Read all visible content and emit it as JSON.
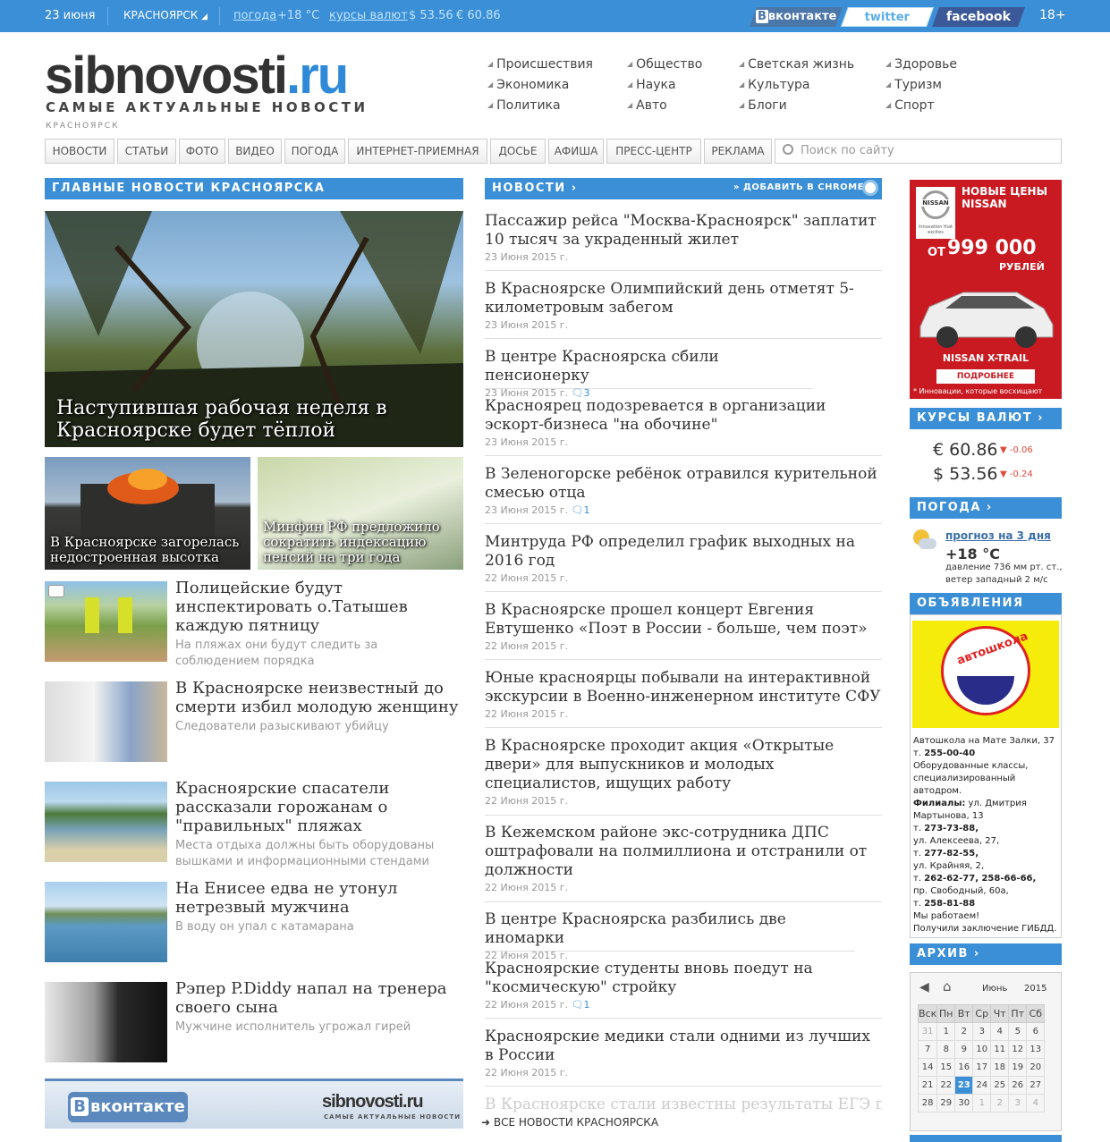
{
  "topbar": {
    "date": "23 июня",
    "city": "КРАСНОЯРСК",
    "weather_label": "погода",
    "weather_value": "+18 °С",
    "rates_label": "курсы валют",
    "usd": "$ 53.56",
    "eur": "€ 60.86",
    "vk": "вконтакте",
    "twitter": "twitter",
    "facebook": "facebook",
    "age": "18+"
  },
  "header": {
    "logo_main": "sibnovosti",
    "logo_tld": ".ru",
    "slogan": "САМЫЕ АКТУАЛЬНЫЕ НОВОСТИ",
    "city": "КРАСНОЯРСК"
  },
  "categories": [
    "Происшествия",
    "Экономика",
    "Политика",
    "Общество",
    "Наука",
    "Авто",
    "Светская жизнь",
    "Культура",
    "Блоги",
    "Здоровье",
    "Туризм",
    "Спорт"
  ],
  "nav": [
    "НОВОСТИ",
    "СТАТЬИ",
    "ФОТО",
    "ВИДЕО",
    "ПОГОДА",
    "ИНТЕРНЕТ-ПРИЕМНАЯ",
    "ДОСЬЕ",
    "АФИША",
    "ПРЕСС-ЦЕНТР",
    "РЕКЛАМА"
  ],
  "search": {
    "placeholder": "Поиск по сайту"
  },
  "main": {
    "section_title": "ГЛАВНЫЕ НОВОСТИ КРАСНОЯРСКА",
    "hero_title": "Наступившая рабочая неделя в Красноярске будет тёплой",
    "sub1": "В Красноярске загорелась недостроенная высотка",
    "sub2": "Минфин РФ предложило сократить индексацию пенсий на три года",
    "list": [
      {
        "title": "Полицейские будут инспектировать о.Татышев каждую пятницу",
        "desc": "На пляжах они будут следить за соблюдением порядка"
      },
      {
        "title": "В Красноярске неизвестный до смерти избил молодую женщину",
        "desc": "Следователи разыскивают убийцу"
      },
      {
        "title": "Красноярские спасатели рассказали горожанам о \"правильных\" пляжах",
        "desc": "Места отдыха должны быть оборудованы вышками и информационными стендами"
      },
      {
        "title": "На Енисее едва не утонул нетрезвый мужчина",
        "desc": "В воду он упал с катамарана"
      },
      {
        "title": "Рэпер P.Diddy напал на тренера своего сына",
        "desc": "Мужчине исполнитель угрожал гирей"
      }
    ],
    "vk_banner_left": "вконтакте",
    "vk_banner_logo": "sibnovosti.ru",
    "vk_banner_slogan": "САМЫЕ АКТУАЛЬНЫЕ НОВОСТИ"
  },
  "news": {
    "section_title": "НОВОСТИ",
    "chrome": "» ДОБАВИТЬ В CHROME",
    "items": [
      {
        "title": "Пассажир рейса \"Москва-Красноярск\" заплатит 10 тысяч за украденный жилет",
        "date": "23 Июня 2015 г.",
        "comments": ""
      },
      {
        "title": "В Красноярске Олимпийский день отметят 5-километровым забегом",
        "date": "23 Июня 2015 г.",
        "comments": ""
      },
      {
        "title": "В центре Красноярска сбили пенсионерку",
        "date": "23 Июня 2015 г.",
        "comments": "3"
      },
      {
        "title": "Красноярец подозревается в организации эскорт-бизнеса \"на обочине\"",
        "date": "23 Июня 2015 г.",
        "comments": ""
      },
      {
        "title": "В Зеленогорске ребёнок отравился курительной смесью отца",
        "date": "23 Июня 2015 г.",
        "comments": "1"
      },
      {
        "title": "Минтруда РФ определил график выходных на 2016 год",
        "date": "22 Июня 2015 г.",
        "comments": ""
      },
      {
        "title": "В Красноярске прошел концерт Евгения Евтушенко «Поэт в России - больше, чем поэт»",
        "date": "22 Июня 2015 г.",
        "comments": ""
      },
      {
        "title": "Юные красноярцы побывали на интерактивной экскурсии в Военно-инженерном институте СФУ",
        "date": "22 Июня 2015 г.",
        "comments": ""
      },
      {
        "title": "В Красноярске проходит акция «Открытые двери» для выпускников и молодых специалистов, ищущих работу",
        "date": "22 Июня 2015 г.",
        "comments": ""
      },
      {
        "title": "В Кежемском районе экс-сотрудника ДПС оштрафовали на полмиллиона и отстранили от должности",
        "date": "22 Июня 2015 г.",
        "comments": ""
      },
      {
        "title": "В центре Красноярска разбились две иномарки",
        "date": "22 Июня 2015 г.",
        "comments": ""
      },
      {
        "title": "Красноярские студенты вновь поедут на \"космическую\" стройку",
        "date": "22 Июня 2015 г.",
        "comments": "1"
      },
      {
        "title": "Красноярские медики стали одними из лучших в России",
        "date": "22 Июня 2015 г.",
        "comments": ""
      }
    ],
    "faded": "В Красноярске стали известны результаты ЕГЭ по",
    "all_link": "ВСЕ НОВОСТИ КРАСНОЯРСКА"
  },
  "sidebar": {
    "ad": {
      "brand": "NISSAN",
      "tagline": "Innovation that excites",
      "headline": "НОВЫЕ ЦЕНЫ NISSAN",
      "from": "ОТ",
      "price": "999 000",
      "currency": "РУБЛЕЙ",
      "model": "NISSAN X-TRAIL",
      "more": "ПОДРОБНЕЕ",
      "footer": "* Инновации, которые восхищают"
    },
    "rates_title": "КУРСЫ ВАЛЮТ",
    "eur": "€ 60.86",
    "eur_delta": "-0.06",
    "usd": "$ 53.56",
    "usd_delta": "-0.24",
    "weather_title": "ПОГОДА",
    "forecast_link": "прогноз на 3 дня",
    "temp": "+18 °С",
    "pressure": "давление 736 мм рт. ст.,",
    "wind": "ветер западный 2 м/с",
    "ads_title": "ОБЪЯВЛЕНИЯ",
    "school_logo": "автошкола",
    "school_lines": [
      {
        "t": "Автошкола на Мате Залки, 37",
        "b": false
      },
      {
        "t": "т. ",
        "bold": "255-00-40"
      },
      {
        "t": "Оборудованные классы,",
        "b": false
      },
      {
        "t": "специализированный",
        "b": false
      },
      {
        "t": "автодром.",
        "b": false
      },
      {
        "t": "",
        "bold": "Филиалы:",
        "after": " ул. Дмитрия"
      },
      {
        "t": "Мартынова, 13",
        "b": false
      },
      {
        "t": "т. ",
        "bold": "273-73-88,"
      },
      {
        "t": "ул. Алексеева, 27,",
        "b": false
      },
      {
        "t": "т. ",
        "bold": "277-82-55,"
      },
      {
        "t": "ул. Крайняя, 2,",
        "b": false
      },
      {
        "t": "т. ",
        "bold": "262-62-77, 258-66-66,"
      },
      {
        "t": "пр. Свободный, 60а,",
        "b": false
      },
      {
        "t": "т. ",
        "bold": "258-81-88"
      },
      {
        "t": "Мы работаем!",
        "b": false
      },
      {
        "t": "Получили заключение ГИБДД.",
        "b": false
      }
    ],
    "archive_title": "АРХИВ",
    "calendar": {
      "month": "Июнь",
      "year": "2015",
      "days": [
        "Вск",
        "Пн",
        "Вт",
        "Ср",
        "Чт",
        "Пт",
        "Сб"
      ],
      "weeks": [
        [
          "31",
          "1",
          "2",
          "3",
          "4",
          "5",
          "6"
        ],
        [
          "7",
          "8",
          "9",
          "10",
          "11",
          "12",
          "13"
        ],
        [
          "14",
          "15",
          "16",
          "17",
          "18",
          "19",
          "20"
        ],
        [
          "21",
          "22",
          "23",
          "24",
          "25",
          "26",
          "27"
        ],
        [
          "28",
          "29",
          "30",
          "1",
          "2",
          "3",
          "4"
        ]
      ],
      "today": "23"
    }
  }
}
